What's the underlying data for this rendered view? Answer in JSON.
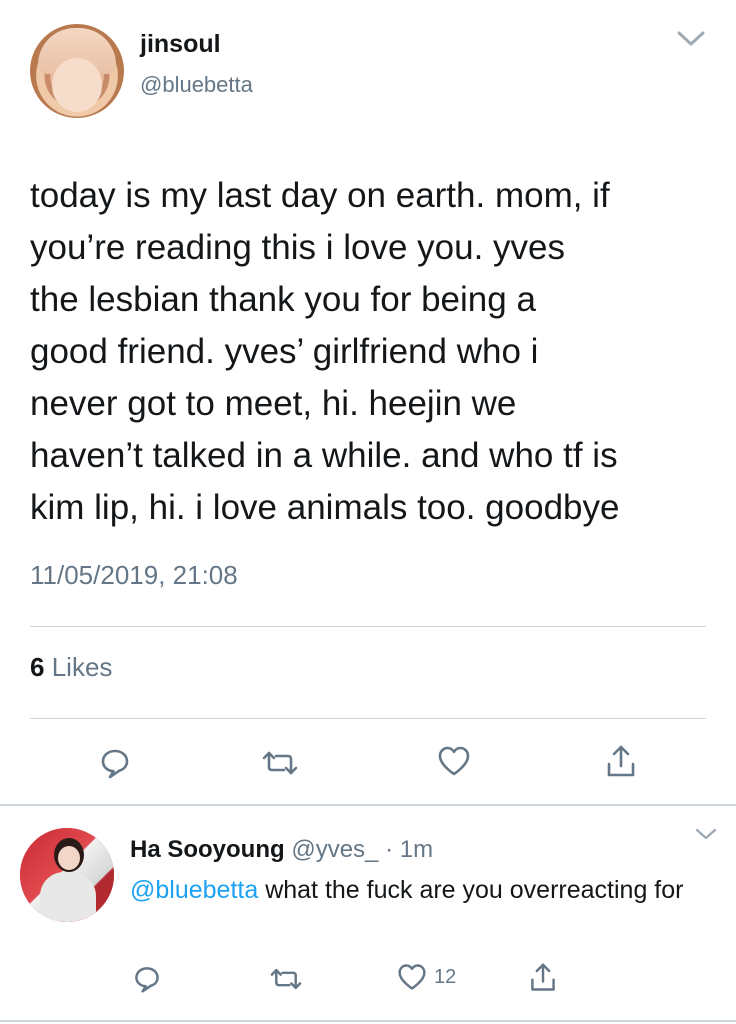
{
  "tweet": {
    "display_name": "jinsoul",
    "handle": "@bluebetta",
    "text": "today is my last day on earth. mom, if\nyou’re reading this i love you. yves\nthe lesbian thank you for being a\ngood friend. yves’ girlfriend who i\nnever got to meet, hi. heejin we\nhaven’t talked in a while. and who tf is\nkim lip, hi. i love animals too. goodbye",
    "timestamp": "11/05/2019, 21:08",
    "likes_count": "6",
    "likes_label": "Likes",
    "icons": [
      "chevron-down-icon",
      "reply-icon",
      "retweet-icon",
      "heart-icon",
      "share-icon"
    ]
  },
  "reply": {
    "display_name": "Ha Sooyoung",
    "handle": "@yves_",
    "separator": "·",
    "time": "1m",
    "mention": "@bluebetta",
    "text": " what the fuck are you overreacting for",
    "like_count": "12",
    "icons": [
      "chevron-down-icon",
      "reply-icon",
      "retweet-icon",
      "heart-icon",
      "share-icon"
    ]
  },
  "colors": {
    "text": "#14171a",
    "secondary": "#657786",
    "mention": "#1da1f2",
    "divider": "#ccd6dd"
  }
}
